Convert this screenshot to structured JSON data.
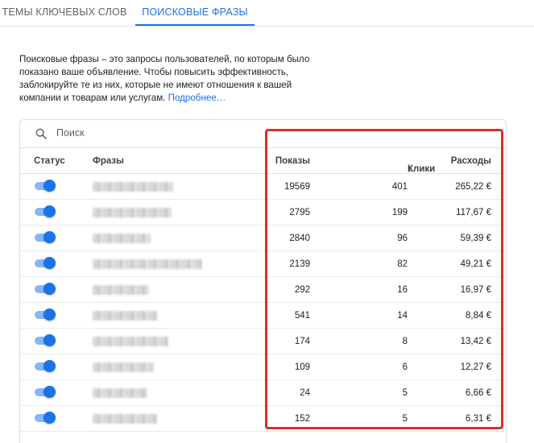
{
  "tabs": [
    {
      "label": "ТЕМЫ КЛЮЧЕВЫХ СЛОВ",
      "active": false
    },
    {
      "label": "ПОИСКОВЫЕ ФРАЗЫ",
      "active": true
    }
  ],
  "description": {
    "text": "Поисковые фразы – это запросы пользователей, по которым было показано ваше объявление. Чтобы повысить эффективность, заблокируйте те из них, которые не имеют отношения к вашей компании и товарам или услугам.",
    "link": "Подробнее…"
  },
  "search": {
    "placeholder": "Поиск",
    "icon": "search-icon"
  },
  "table": {
    "headers": {
      "status": "Статус",
      "phrase": "Фразы",
      "impressions": "Показы",
      "clicks": "Клики",
      "cost": "Расходы",
      "sort_indicator": "↓"
    },
    "rows": [
      {
        "enabled": true,
        "impressions": "19569",
        "clicks": "401",
        "cost": "265,22 €"
      },
      {
        "enabled": true,
        "impressions": "2795",
        "clicks": "199",
        "cost": "117,67 €"
      },
      {
        "enabled": true,
        "impressions": "2840",
        "clicks": "96",
        "cost": "59,39 €"
      },
      {
        "enabled": true,
        "impressions": "2139",
        "clicks": "82",
        "cost": "49,21 €"
      },
      {
        "enabled": true,
        "impressions": "292",
        "clicks": "16",
        "cost": "16,97 €"
      },
      {
        "enabled": true,
        "impressions": "541",
        "clicks": "14",
        "cost": "8,84 €"
      },
      {
        "enabled": true,
        "impressions": "174",
        "clicks": "8",
        "cost": "13,42 €"
      },
      {
        "enabled": true,
        "impressions": "109",
        "clicks": "6",
        "cost": "12,27 €"
      },
      {
        "enabled": true,
        "impressions": "24",
        "clicks": "5",
        "cost": "6,66 €"
      },
      {
        "enabled": true,
        "impressions": "152",
        "clicks": "5",
        "cost": "6,31 €"
      }
    ]
  },
  "colors": {
    "accent": "#1a73e8",
    "highlight": "#d93025"
  }
}
